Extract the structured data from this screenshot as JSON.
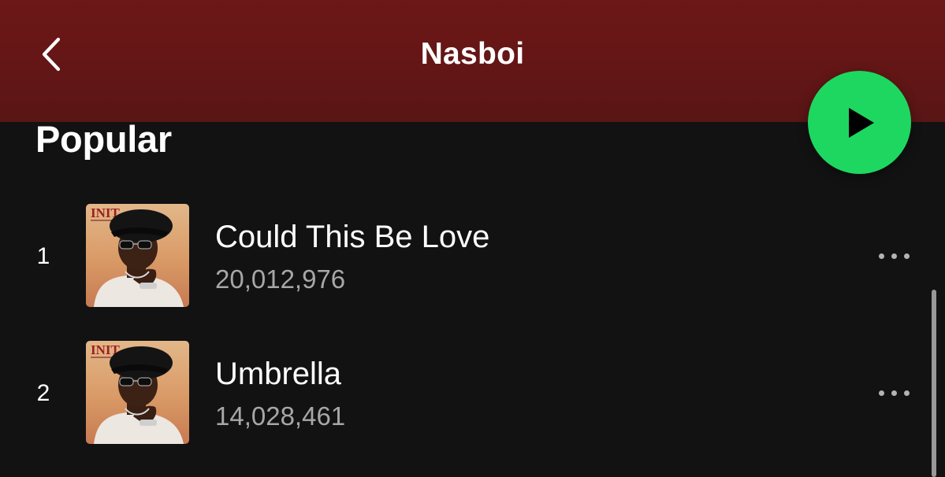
{
  "header": {
    "title": "Nasboi",
    "back_icon": "chevron-left-icon",
    "background": "#6d1717"
  },
  "play_button": {
    "icon": "play-icon",
    "color": "#1ed760"
  },
  "section": {
    "title": "Popular"
  },
  "tracks": [
    {
      "index": "1",
      "title": "Could This Be Love",
      "plays": "20,012,976",
      "cover_text": "INIT",
      "more_icon": "more-horizontal-icon"
    },
    {
      "index": "2",
      "title": "Umbrella",
      "plays": "14,028,461",
      "cover_text": "INIT",
      "more_icon": "more-horizontal-icon"
    }
  ],
  "colors": {
    "background": "#121212",
    "secondary_text": "#a7a7a7"
  }
}
